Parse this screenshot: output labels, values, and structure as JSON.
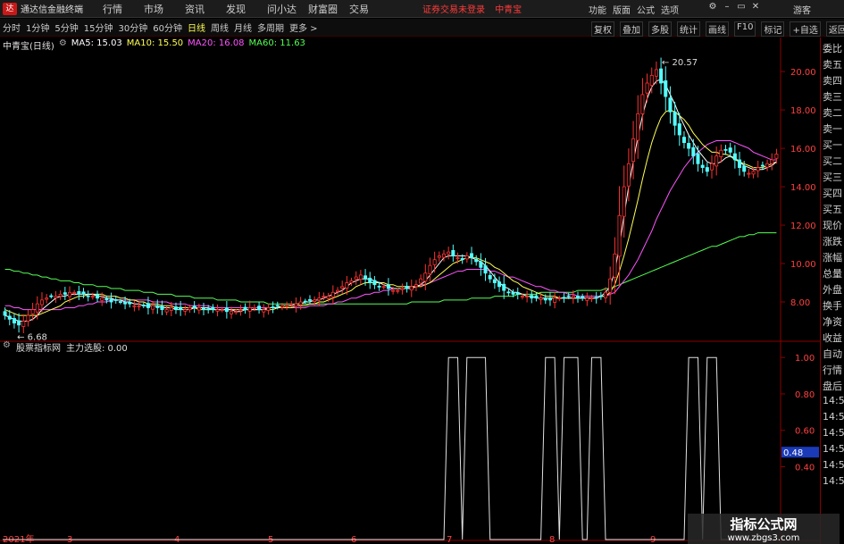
{
  "titlebar": {
    "app_title": "通达信金融终端",
    "menu": [
      "行情",
      "市场",
      "资讯",
      "发现",
      "问小达",
      "财富圈",
      "交易"
    ],
    "login_status": "证券交易未登录",
    "stock_name": "中青宝",
    "right_menu": [
      "功能",
      "版面",
      "公式",
      "选项"
    ],
    "guest": "游客",
    "logo": "达"
  },
  "period_bar": {
    "tabs": [
      "分时",
      "1分钟",
      "5分钟",
      "15分钟",
      "30分钟",
      "60分钟",
      "日线",
      "周线",
      "月线",
      "多周期",
      "更多 >"
    ],
    "active_tab": "日线",
    "tools": [
      "复权",
      "叠加",
      "多股",
      "统计",
      "画线",
      "F10",
      "标记",
      "+自选",
      "返回"
    ]
  },
  "stock_header": {
    "name": "中青宝(日线)",
    "ma5": "MA5: 15.03",
    "ma10": "MA10: 15.50",
    "ma20": "MA20: 16.08",
    "ma60": "MA60: 11.63"
  },
  "indicator_header": {
    "source": "股票指标网",
    "name": "主力选股: 0.00"
  },
  "side_column": [
    "委比",
    "卖五",
    "卖四",
    "卖三",
    "卖二",
    "卖一",
    "买一",
    "买二",
    "买三",
    "买四",
    "买五",
    "现价",
    "涨跌",
    "涨幅",
    "总量",
    "外盘",
    "换手",
    "净资",
    "收益",
    "自动",
    "行情",
    "盘后",
    "14:56",
    "14:56",
    "14:56",
    "14:56",
    "14:56",
    "14:56"
  ],
  "watermark": {
    "title": "指标公式网",
    "url": "www.zbgs3.com"
  },
  "colors": {
    "up": "#ff3232",
    "down": "#54ffff",
    "ma5": "#ffffff",
    "ma10": "#ffff54",
    "ma20": "#ff54ff",
    "ma60": "#54ff54",
    "axis": "#8b0000"
  },
  "chart_data": {
    "type": "candlestick",
    "y_ticks": [
      "20.00",
      "18.00",
      "16.00",
      "14.00",
      "12.00",
      "10.00",
      "8.00"
    ],
    "y_tick_values": [
      20,
      18,
      16,
      14,
      12,
      10,
      8
    ],
    "ylim": [
      6.0,
      21.4
    ],
    "high_label": "20.57",
    "low_label": "6.68",
    "x_labels": [
      "2021年",
      "3",
      "4",
      "5",
      "6",
      "7",
      "8",
      "9"
    ],
    "indicator_ticks": [
      "1.00",
      "0.80",
      "0.60",
      "0.40"
    ],
    "indicator_tick_values": [
      1.0,
      0.8,
      0.6,
      0.4
    ],
    "indicator_current": "0.48",
    "indicator_value": 0.48,
    "indicator_ylim": [
      0.0,
      1.06
    ],
    "candle_count": 170,
    "close": [
      7.3,
      7.1,
      6.9,
      6.8,
      7.0,
      7.3,
      7.6,
      7.9,
      8.1,
      8.2,
      8.3,
      8.3,
      8.4,
      8.4,
      8.5,
      8.5,
      8.4,
      8.4,
      8.3,
      8.3,
      8.2,
      8.2,
      8.1,
      8.0,
      8.1,
      8.0,
      7.9,
      7.9,
      7.8,
      7.8,
      7.8,
      7.7,
      7.8,
      7.7,
      7.6,
      7.6,
      7.7,
      7.6,
      7.6,
      7.6,
      7.7,
      7.7,
      7.7,
      7.6,
      7.6,
      7.6,
      7.6,
      7.6,
      7.5,
      7.5,
      7.5,
      7.6,
      7.6,
      7.7,
      7.7,
      7.6,
      7.6,
      7.7,
      7.7,
      7.8,
      7.8,
      7.8,
      7.9,
      7.9,
      8.0,
      8.0,
      8.1,
      8.1,
      8.2,
      8.3,
      8.3,
      8.5,
      8.6,
      8.8,
      9.0,
      9.1,
      9.3,
      9.4,
      9.2,
      9.0,
      8.9,
      8.8,
      8.8,
      8.7,
      8.6,
      8.6,
      8.7,
      8.7,
      8.8,
      8.9,
      9.2,
      9.5,
      9.9,
      10.2,
      10.4,
      10.5,
      10.6,
      10.4,
      10.3,
      10.2,
      10.4,
      10.3,
      10.1,
      9.8,
      9.5,
      9.2,
      9.0,
      8.8,
      8.6,
      8.5,
      8.4,
      8.4,
      8.3,
      8.3,
      8.2,
      8.2,
      8.2,
      8.1,
      8.1,
      8.2,
      8.2,
      8.2,
      8.3,
      8.3,
      8.2,
      8.2,
      8.2,
      8.2,
      8.2,
      8.3,
      8.5,
      9.2,
      10.5,
      12.5,
      14.0,
      15.2,
      16.5,
      17.8,
      18.8,
      19.4,
      19.8,
      20.1,
      19.4,
      18.7,
      17.9,
      17.2,
      16.7,
      16.3,
      16.0,
      15.6,
      15.2,
      15.0,
      14.8,
      15.2,
      15.6,
      15.9,
      15.9,
      15.8,
      15.4,
      15.0,
      14.8,
      14.7,
      14.8,
      15.0,
      15.1,
      15.2,
      15.4,
      15.7
    ],
    "ma5": [
      7.3,
      7.2,
      7.1,
      7.0,
      7.0,
      7.0,
      7.1,
      7.3,
      7.6,
      7.8,
      8.0,
      8.2,
      8.3,
      8.3,
      8.4,
      8.4,
      8.4,
      8.4,
      8.4,
      8.4,
      8.3,
      8.3,
      8.2,
      8.2,
      8.1,
      8.1,
      8.0,
      8.0,
      7.9,
      7.9,
      7.8,
      7.8,
      7.8,
      7.8,
      7.7,
      7.7,
      7.7,
      7.6,
      7.6,
      7.6,
      7.6,
      7.7,
      7.7,
      7.7,
      7.7,
      7.6,
      7.6,
      7.6,
      7.6,
      7.6,
      7.5,
      7.5,
      7.6,
      7.6,
      7.6,
      7.6,
      7.6,
      7.7,
      7.7,
      7.7,
      7.8,
      7.8,
      7.8,
      7.9,
      7.9,
      8.0,
      8.0,
      8.1,
      8.1,
      8.2,
      8.3,
      8.4,
      8.5,
      8.6,
      8.8,
      9.0,
      9.1,
      9.2,
      9.2,
      9.2,
      9.1,
      9.0,
      8.9,
      8.8,
      8.7,
      8.7,
      8.7,
      8.7,
      8.7,
      8.8,
      8.9,
      9.1,
      9.4,
      9.7,
      10.0,
      10.3,
      10.4,
      10.4,
      10.4,
      10.4,
      10.4,
      10.3,
      10.2,
      10.1,
      9.9,
      9.6,
      9.3,
      9.0,
      8.8,
      8.7,
      8.5,
      8.5,
      8.4,
      8.3,
      8.3,
      8.2,
      8.2,
      8.2,
      8.2,
      8.2,
      8.2,
      8.2,
      8.2,
      8.2,
      8.2,
      8.2,
      8.2,
      8.2,
      8.2,
      8.3,
      8.5,
      8.8,
      9.6,
      10.9,
      12.5,
      14.0,
      15.3,
      16.6,
      17.7,
      18.6,
      19.2,
      19.5,
      19.6,
      19.3,
      18.8,
      18.3,
      17.7,
      17.2,
      16.7,
      16.3,
      15.9,
      15.6,
      15.3,
      15.2,
      15.2,
      15.3,
      15.5,
      15.6,
      15.5,
      15.3,
      15.1,
      15.0,
      14.9,
      14.9,
      14.9,
      15.0,
      15.1,
      15.3
    ],
    "ma10": [
      7.6,
      7.5,
      7.4,
      7.3,
      7.3,
      7.3,
      7.3,
      7.3,
      7.4,
      7.5,
      7.6,
      7.7,
      7.8,
      8.0,
      8.1,
      8.2,
      8.3,
      8.3,
      8.4,
      8.4,
      8.4,
      8.4,
      8.3,
      8.3,
      8.3,
      8.2,
      8.2,
      8.1,
      8.1,
      8.0,
      8.0,
      7.9,
      7.9,
      7.9,
      7.8,
      7.8,
      7.8,
      7.7,
      7.7,
      7.7,
      7.7,
      7.7,
      7.6,
      7.6,
      7.6,
      7.6,
      7.6,
      7.6,
      7.6,
      7.6,
      7.6,
      7.6,
      7.6,
      7.6,
      7.6,
      7.6,
      7.6,
      7.6,
      7.6,
      7.7,
      7.7,
      7.7,
      7.7,
      7.8,
      7.8,
      7.8,
      7.9,
      7.9,
      8.0,
      8.0,
      8.1,
      8.2,
      8.3,
      8.4,
      8.5,
      8.6,
      8.8,
      8.9,
      9.0,
      9.0,
      9.0,
      9.0,
      9.0,
      8.9,
      8.9,
      8.8,
      8.8,
      8.8,
      8.8,
      8.8,
      8.8,
      8.9,
      9.0,
      9.2,
      9.4,
      9.6,
      9.8,
      10.0,
      10.1,
      10.2,
      10.3,
      10.3,
      10.3,
      10.2,
      10.1,
      10.0,
      9.8,
      9.7,
      9.5,
      9.3,
      9.1,
      9.0,
      8.8,
      8.7,
      8.6,
      8.5,
      8.4,
      8.3,
      8.3,
      8.3,
      8.2,
      8.2,
      8.2,
      8.2,
      8.2,
      8.2,
      8.2,
      8.2,
      8.2,
      8.3,
      8.3,
      8.5,
      8.9,
      9.6,
      10.4,
      11.3,
      12.3,
      13.3,
      14.4,
      15.4,
      16.3,
      17.0,
      17.6,
      17.9,
      18.0,
      17.9,
      17.7,
      17.5,
      17.2,
      16.8,
      16.5,
      16.2,
      16.0,
      15.8,
      15.8,
      15.7,
      15.7,
      15.6,
      15.4,
      15.3,
      15.2,
      15.1,
      15.0,
      15.0,
      15.0,
      15.1,
      15.2,
      15.3
    ],
    "ma20": [
      7.8,
      7.8,
      7.7,
      7.7,
      7.6,
      7.6,
      7.6,
      7.6,
      7.6,
      7.6,
      7.6,
      7.6,
      7.6,
      7.7,
      7.7,
      7.7,
      7.8,
      7.8,
      7.9,
      7.9,
      8.0,
      8.0,
      8.0,
      8.1,
      8.1,
      8.1,
      8.1,
      8.1,
      8.1,
      8.1,
      8.1,
      8.1,
      8.0,
      8.0,
      8.0,
      8.0,
      7.9,
      7.9,
      7.9,
      7.9,
      7.8,
      7.8,
      7.8,
      7.8,
      7.8,
      7.7,
      7.7,
      7.7,
      7.7,
      7.7,
      7.7,
      7.7,
      7.7,
      7.7,
      7.7,
      7.7,
      7.7,
      7.7,
      7.7,
      7.7,
      7.7,
      7.7,
      7.7,
      7.7,
      7.7,
      7.7,
      7.8,
      7.8,
      7.8,
      7.8,
      7.9,
      7.9,
      8.0,
      8.0,
      8.1,
      8.2,
      8.2,
      8.3,
      8.4,
      8.4,
      8.5,
      8.5,
      8.6,
      8.6,
      8.7,
      8.7,
      8.7,
      8.7,
      8.8,
      8.8,
      8.9,
      8.9,
      9.0,
      9.1,
      9.2,
      9.3,
      9.4,
      9.5,
      9.6,
      9.6,
      9.7,
      9.7,
      9.7,
      9.7,
      9.7,
      9.6,
      9.6,
      9.5,
      9.4,
      9.3,
      9.3,
      9.2,
      9.1,
      9.0,
      8.9,
      8.8,
      8.8,
      8.7,
      8.6,
      8.6,
      8.5,
      8.5,
      8.4,
      8.4,
      8.3,
      8.3,
      8.3,
      8.3,
      8.3,
      8.3,
      8.3,
      8.4,
      8.5,
      8.8,
      9.1,
      9.4,
      9.8,
      10.2,
      10.7,
      11.2,
      11.7,
      12.3,
      12.8,
      13.3,
      13.8,
      14.2,
      14.6,
      15.0,
      15.3,
      15.6,
      15.8,
      16.0,
      16.2,
      16.3,
      16.4,
      16.4,
      16.4,
      16.4,
      16.3,
      16.2,
      16.1,
      16.0,
      15.8,
      15.7,
      15.6,
      15.5,
      15.4,
      15.4
    ],
    "ma60": [
      9.7,
      9.7,
      9.6,
      9.6,
      9.5,
      9.5,
      9.4,
      9.4,
      9.3,
      9.3,
      9.2,
      9.2,
      9.1,
      9.1,
      9.1,
      9.0,
      9.0,
      8.9,
      8.9,
      8.9,
      8.8,
      8.8,
      8.8,
      8.7,
      8.7,
      8.7,
      8.6,
      8.6,
      8.6,
      8.6,
      8.5,
      8.5,
      8.5,
      8.4,
      8.4,
      8.4,
      8.4,
      8.3,
      8.3,
      8.3,
      8.3,
      8.2,
      8.2,
      8.2,
      8.2,
      8.2,
      8.1,
      8.1,
      8.1,
      8.1,
      8.1,
      8.0,
      8.0,
      8.0,
      8.0,
      8.0,
      8.0,
      7.9,
      7.9,
      7.9,
      7.9,
      7.9,
      7.9,
      7.9,
      7.9,
      7.9,
      7.9,
      7.9,
      7.9,
      7.9,
      7.9,
      7.9,
      7.9,
      7.9,
      7.9,
      7.9,
      7.9,
      7.9,
      7.9,
      7.9,
      7.9,
      7.9,
      7.9,
      7.9,
      7.9,
      7.9,
      7.9,
      7.9,
      8.0,
      8.0,
      8.0,
      8.0,
      8.0,
      8.0,
      8.0,
      8.1,
      8.1,
      8.1,
      8.1,
      8.1,
      8.1,
      8.2,
      8.2,
      8.2,
      8.2,
      8.2,
      8.3,
      8.3,
      8.3,
      8.3,
      8.3,
      8.4,
      8.4,
      8.4,
      8.4,
      8.4,
      8.5,
      8.5,
      8.5,
      8.5,
      8.5,
      8.5,
      8.5,
      8.5,
      8.6,
      8.6,
      8.6,
      8.6,
      8.6,
      8.6,
      8.7,
      8.7,
      8.8,
      8.9,
      9.0,
      9.1,
      9.2,
      9.3,
      9.4,
      9.5,
      9.6,
      9.7,
      9.8,
      9.9,
      10.0,
      10.1,
      10.2,
      10.3,
      10.4,
      10.5,
      10.6,
      10.7,
      10.8,
      10.9,
      10.9,
      11.0,
      11.1,
      11.2,
      11.3,
      11.4,
      11.4,
      11.5,
      11.5,
      11.6,
      11.6,
      11.6,
      11.6,
      11.6
    ],
    "signal_pulses": [
      [
        96,
        98
      ],
      [
        100,
        104
      ],
      [
        117,
        119
      ],
      [
        121,
        124
      ],
      [
        127,
        129
      ],
      [
        148,
        150
      ],
      [
        152,
        154
      ]
    ]
  }
}
